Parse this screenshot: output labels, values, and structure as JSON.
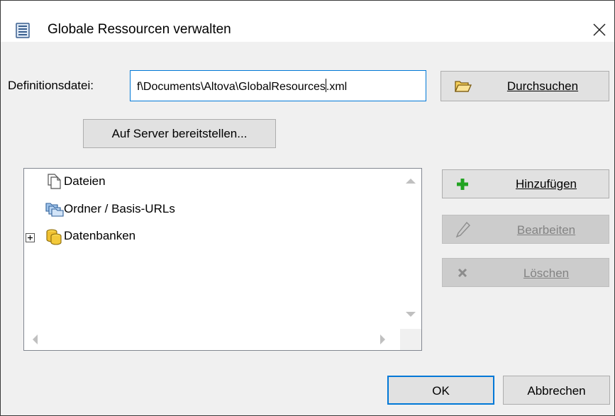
{
  "window": {
    "title": "Globale Ressourcen verwalten",
    "title_icon": "document-list-icon",
    "close_icon": "close-icon"
  },
  "definition": {
    "label": "Definitionsdatei:",
    "value": "f\\Documents\\Altova\\GlobalResources",
    "value_after_caret": ".xml"
  },
  "buttons": {
    "browse": "Durchsuchen",
    "deploy": "Auf Server bereitstellen...",
    "add": "Hinzufügen",
    "edit": "Bearbeiten",
    "delete": "Löschen",
    "ok": "OK",
    "cancel": "Abbrechen"
  },
  "tree": {
    "items": [
      {
        "label": "Dateien",
        "icon": "files-icon",
        "expandable": false
      },
      {
        "label": "Ordner / Basis-URLs",
        "icon": "folders-icon",
        "expandable": false
      },
      {
        "label": "Datenbanken",
        "icon": "database-icon",
        "expandable": true,
        "expander": "plus"
      }
    ]
  },
  "colors": {
    "dialog_bg": "#f0f0f0",
    "button_bg": "#e1e1e1",
    "disabled_button_bg": "#cccccc",
    "focus_border": "#0078d7",
    "ok_border": "#0078d7",
    "add_icon": "#22a322"
  }
}
